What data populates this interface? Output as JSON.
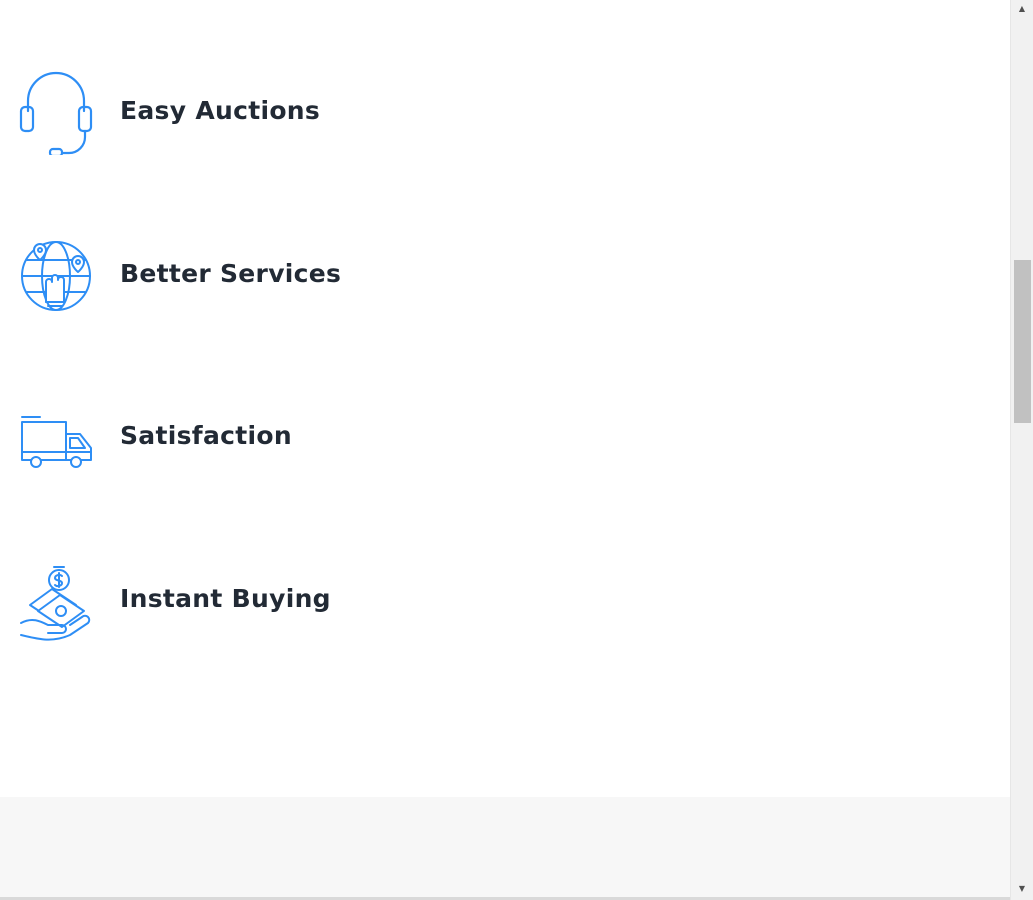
{
  "features": [
    {
      "label": "Easy Auctions",
      "icon": "headset-icon"
    },
    {
      "label": "Better Services",
      "icon": "globe-location-icon"
    },
    {
      "label": "Satisfaction",
      "icon": "delivery-truck-icon"
    },
    {
      "label": "Instant Buying",
      "icon": "money-hand-icon"
    }
  ],
  "colors": {
    "icon_accent": "#2e8ef5",
    "text": "#222a35",
    "footer_band": "#f7f7f7"
  },
  "scrollbar": {
    "up_glyph": "▲",
    "down_glyph": "▼"
  }
}
